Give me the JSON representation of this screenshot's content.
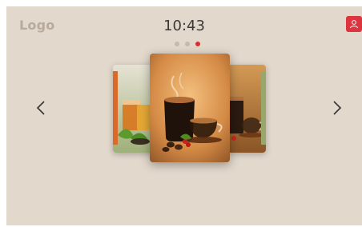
{
  "header": {
    "logo_text": "Logo",
    "time": "10:43",
    "profile_icon": "user-icon",
    "accent_color": "#dc3540"
  },
  "carousel": {
    "total_pages": 3,
    "active_page": 3,
    "prev_icon": "chevron-left-icon",
    "next_icon": "chevron-right-icon",
    "items": [
      {
        "image": "tea-glasses-with-leaves"
      },
      {
        "image": "espresso-and-coffee-cup-with-beans"
      },
      {
        "image": "coffee-glass-and-cup"
      }
    ]
  }
}
